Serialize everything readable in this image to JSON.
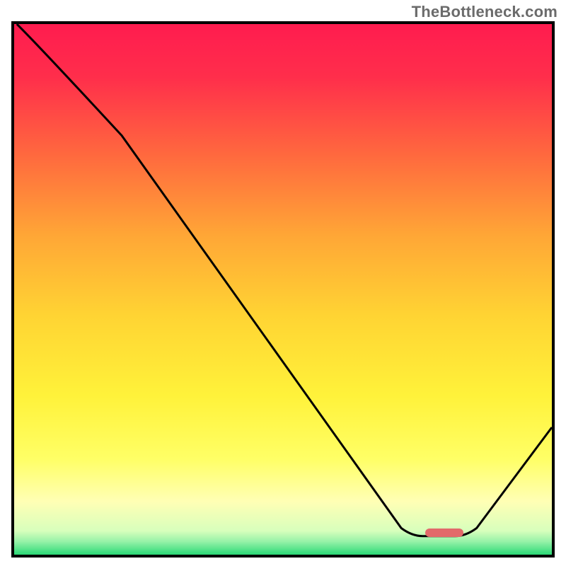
{
  "watermark": "TheBottleneck.com",
  "chart_data": {
    "type": "line",
    "title": "",
    "xlabel": "",
    "ylabel": "",
    "xlim": [
      0,
      100
    ],
    "ylim": [
      0,
      100
    ],
    "grid": false,
    "legend": false,
    "series": [
      {
        "name": "curve",
        "color": "#000000",
        "points": [
          {
            "x": 0.5,
            "y": 100
          },
          {
            "x": 20,
            "y": 79
          },
          {
            "x": 72,
            "y": 5
          },
          {
            "x": 76,
            "y": 3.5
          },
          {
            "x": 82,
            "y": 3.5
          },
          {
            "x": 86,
            "y": 5
          },
          {
            "x": 100,
            "y": 24
          }
        ]
      }
    ],
    "gradient_stops": [
      {
        "offset": 0.0,
        "color": "#ff1c4f"
      },
      {
        "offset": 0.1,
        "color": "#ff2e4b"
      },
      {
        "offset": 0.25,
        "color": "#ff6a3e"
      },
      {
        "offset": 0.4,
        "color": "#ffa736"
      },
      {
        "offset": 0.55,
        "color": "#ffd433"
      },
      {
        "offset": 0.7,
        "color": "#fff23a"
      },
      {
        "offset": 0.82,
        "color": "#ffff66"
      },
      {
        "offset": 0.9,
        "color": "#ffffb5"
      },
      {
        "offset": 0.955,
        "color": "#d8ffbc"
      },
      {
        "offset": 0.975,
        "color": "#97f2a8"
      },
      {
        "offset": 1.0,
        "color": "#2bd977"
      }
    ],
    "marker": {
      "x0": 76.5,
      "x1": 83.5,
      "y": 3.3,
      "height_pct": 1.6,
      "color": "#e26a6a"
    },
    "annotations": []
  }
}
